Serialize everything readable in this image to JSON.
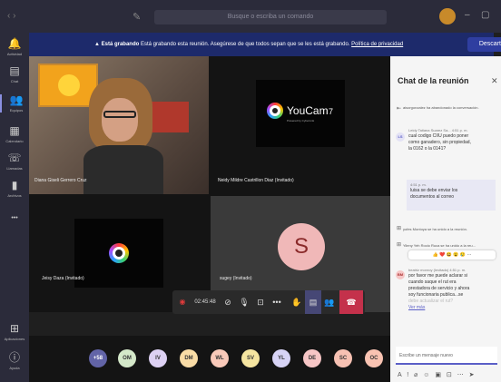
{
  "titlebar": {
    "nav_arrows": "‹ ›",
    "search_placeholder": "Busque o escriba un comando",
    "window_controls": [
      "–",
      "▢"
    ]
  },
  "sidebar": {
    "items": [
      {
        "label": "Actividad",
        "icon": "bell-icon",
        "glyph": "🔔"
      },
      {
        "label": "Chat",
        "icon": "chat-icon",
        "glyph": "▤"
      },
      {
        "label": "Equipos",
        "icon": "teams-icon",
        "glyph": "👥"
      },
      {
        "label": "Calendario",
        "icon": "calendar-icon",
        "glyph": "▦"
      },
      {
        "label": "Llamadas",
        "icon": "phone-icon",
        "glyph": "☏"
      },
      {
        "label": "Archivos",
        "icon": "file-icon",
        "glyph": "▮"
      },
      {
        "label": "...",
        "icon": "more-icon",
        "glyph": "•••"
      },
      {
        "label": "Aplicaciones",
        "icon": "apps-icon",
        "glyph": "⊞"
      },
      {
        "label": "Ayuda",
        "icon": "help-icon",
        "glyph": "ⓘ"
      }
    ]
  },
  "banner": {
    "bold": "Está grabando",
    "message": "Está grabando esta reunión. Asegúrese de que todos sepan que se les está grabando.",
    "link": "Política de privacidad",
    "button": "Descartar",
    "color": "#1d2a6b"
  },
  "tiles": [
    {
      "name": "Diana Giseli Gerrero Cruz"
    },
    {
      "name": "Neidy Mildre Castrillon Diaz (Invitado)",
      "brand": "YouCam",
      "brand_num": "7",
      "brand_sub": "Powered by CyberLink"
    },
    {
      "name": "Jeisy Daza (Invitado)"
    },
    {
      "name": "sugey (Invitado)",
      "initial": "S",
      "avatar_color": "#f0b8b8"
    }
  ],
  "controls": {
    "timer": "02:45:48",
    "recording_color": "#e03b3b",
    "hangup_color": "#c4314b"
  },
  "chat": {
    "title": "Chat de la reunión",
    "sys1": "aisorgonzalez ha abandonado la conversación.",
    "m1": {
      "initials": "LS",
      "author": "Leidy Tatiana Suarez Sa...",
      "time": "4:51 p. m.",
      "text": [
        "cual codigo CIIU puedo poner",
        "como ganadero, sin propiedad,",
        "la 0162 o la 0141?"
      ]
    },
    "reply": {
      "time": "4:51 p. m.",
      "text": [
        "luisa se debe enviar los",
        "documentos al correo"
      ]
    },
    "sys2": "yofes Montoya se ha unido a la reunión.",
    "sys3": "Yileny Yeh Rocio Ruca se ha unido a la reu...",
    "reactions": "👍 ❤️ 😆 😮 😢 ⋯",
    "m2": {
      "initials": "BM",
      "author": "beatriz monroy (Invitado)",
      "time": "4:51 p. m.",
      "text": [
        "por favor me puede aclarar si",
        "cuando saque el rut era",
        "prestadora de servicio y ahora",
        "soy funcionaria publica...se",
        "debe actualizar el rut?"
      ],
      "more": "Ver más"
    },
    "compose_placeholder": "Escribe un mensaje nuevo",
    "tools": "A ! ⌀ ☺ ▣ ⊡ ⋯ ➤"
  },
  "participants": [
    {
      "label": "+58",
      "color": "#6264a7"
    },
    {
      "label": "OM",
      "color": "#d4e8c9"
    },
    {
      "label": "IV",
      "color": "#ddd1f3"
    },
    {
      "label": "DM",
      "color": "#f9dca6"
    },
    {
      "label": "WL",
      "color": "#f9c9b9"
    },
    {
      "label": "SV",
      "color": "#f5e5a0"
    },
    {
      "label": "YL",
      "color": "#d7d3f5"
    },
    {
      "label": "DE",
      "color": "#f6c6c6"
    },
    {
      "label": "SC",
      "color": "#f7c1b3"
    },
    {
      "label": "OC",
      "color": "#f9c3b2"
    }
  ]
}
